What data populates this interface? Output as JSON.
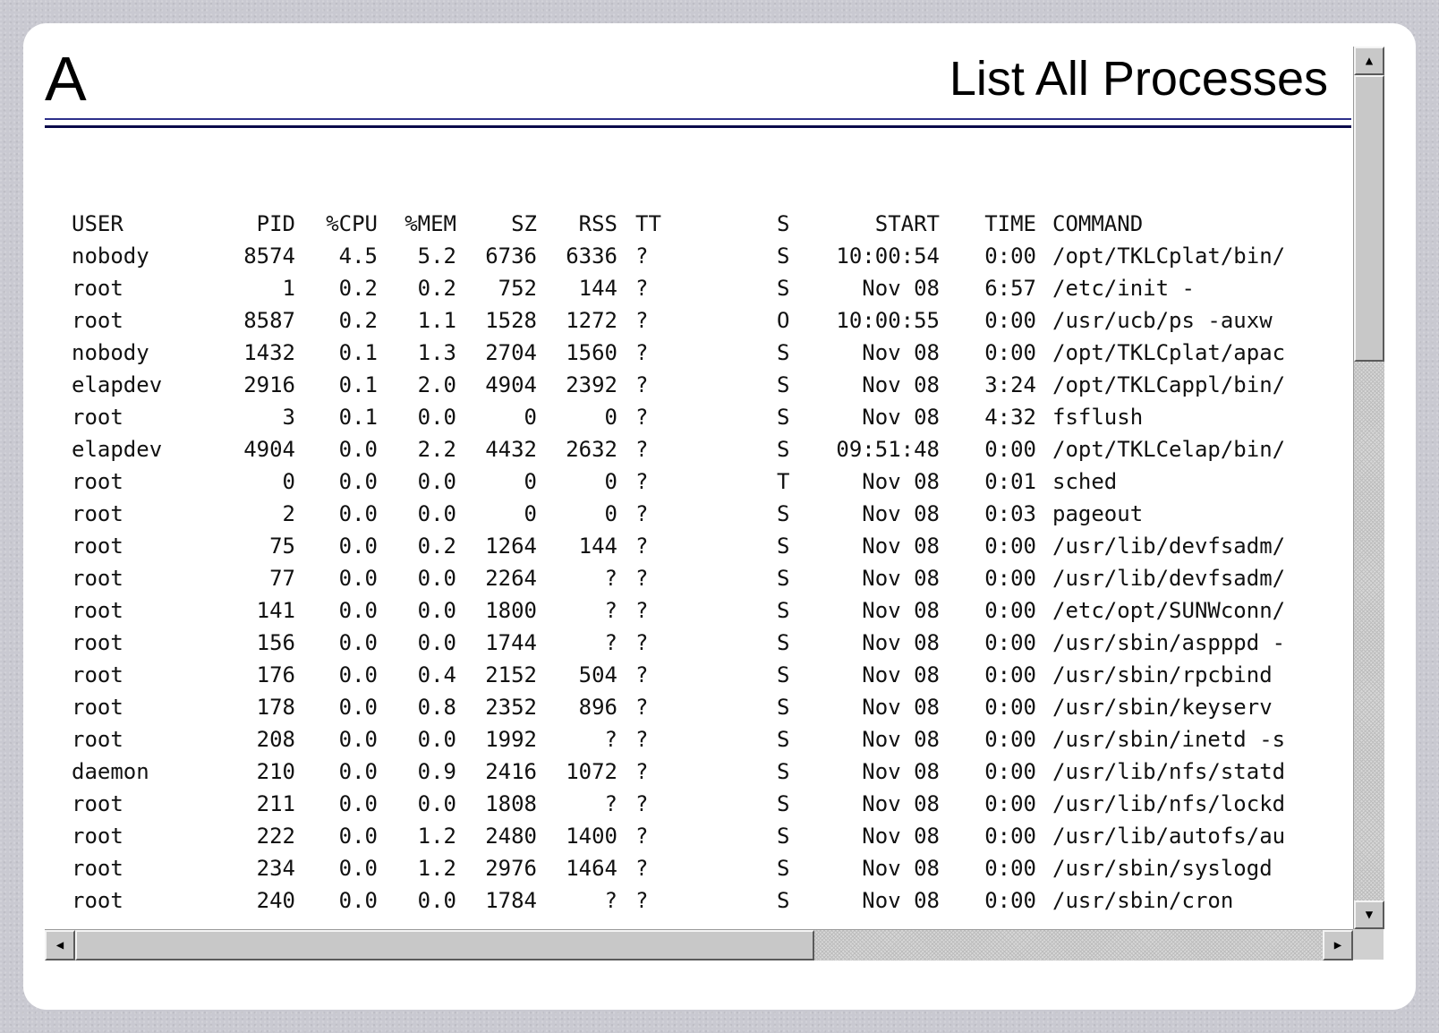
{
  "header": {
    "letter": "A",
    "title": "List All Processes"
  },
  "table": {
    "columns": {
      "user": "USER",
      "pid": "PID",
      "cpu": "%CPU",
      "mem": "%MEM",
      "sz": "SZ",
      "rss": "RSS",
      "tt": "TT",
      "s": "S",
      "start": "START",
      "time": "TIME",
      "command": "COMMAND"
    },
    "rows": [
      {
        "user": "nobody",
        "pid": "8574",
        "cpu": "4.5",
        "mem": "5.2",
        "sz": "6736",
        "rss": "6336",
        "tt": "?",
        "s": "S",
        "start": "10:00:54",
        "time": "0:00",
        "command": "/opt/TKLCplat/bin/"
      },
      {
        "user": "root",
        "pid": "1",
        "cpu": "0.2",
        "mem": "0.2",
        "sz": "752",
        "rss": "144",
        "tt": "?",
        "s": "S",
        "start": "Nov 08",
        "time": "6:57",
        "command": "/etc/init -"
      },
      {
        "user": "root",
        "pid": "8587",
        "cpu": "0.2",
        "mem": "1.1",
        "sz": "1528",
        "rss": "1272",
        "tt": "?",
        "s": "O",
        "start": "10:00:55",
        "time": "0:00",
        "command": "/usr/ucb/ps -auxw"
      },
      {
        "user": "nobody",
        "pid": "1432",
        "cpu": "0.1",
        "mem": "1.3",
        "sz": "2704",
        "rss": "1560",
        "tt": "?",
        "s": "S",
        "start": "Nov 08",
        "time": "0:00",
        "command": "/opt/TKLCplat/apac"
      },
      {
        "user": "elapdev",
        "pid": "2916",
        "cpu": "0.1",
        "mem": "2.0",
        "sz": "4904",
        "rss": "2392",
        "tt": "?",
        "s": "S",
        "start": "Nov 08",
        "time": "3:24",
        "command": "/opt/TKLCappl/bin/"
      },
      {
        "user": "root",
        "pid": "3",
        "cpu": "0.1",
        "mem": "0.0",
        "sz": "0",
        "rss": "0",
        "tt": "?",
        "s": "S",
        "start": "Nov 08",
        "time": "4:32",
        "command": "fsflush"
      },
      {
        "user": "elapdev",
        "pid": "4904",
        "cpu": "0.0",
        "mem": "2.2",
        "sz": "4432",
        "rss": "2632",
        "tt": "?",
        "s": "S",
        "start": "09:51:48",
        "time": "0:00",
        "command": "/opt/TKLCelap/bin/"
      },
      {
        "user": "root",
        "pid": "0",
        "cpu": "0.0",
        "mem": "0.0",
        "sz": "0",
        "rss": "0",
        "tt": "?",
        "s": "T",
        "start": "Nov 08",
        "time": "0:01",
        "command": "sched"
      },
      {
        "user": "root",
        "pid": "2",
        "cpu": "0.0",
        "mem": "0.0",
        "sz": "0",
        "rss": "0",
        "tt": "?",
        "s": "S",
        "start": "Nov 08",
        "time": "0:03",
        "command": "pageout"
      },
      {
        "user": "root",
        "pid": "75",
        "cpu": "0.0",
        "mem": "0.2",
        "sz": "1264",
        "rss": "144",
        "tt": "?",
        "s": "S",
        "start": "Nov 08",
        "time": "0:00",
        "command": "/usr/lib/devfsadm/"
      },
      {
        "user": "root",
        "pid": "77",
        "cpu": "0.0",
        "mem": "0.0",
        "sz": "2264",
        "rss": "?",
        "tt": "?",
        "s": "S",
        "start": "Nov 08",
        "time": "0:00",
        "command": "/usr/lib/devfsadm/"
      },
      {
        "user": "root",
        "pid": "141",
        "cpu": "0.0",
        "mem": "0.0",
        "sz": "1800",
        "rss": "?",
        "tt": "?",
        "s": "S",
        "start": "Nov 08",
        "time": "0:00",
        "command": "/etc/opt/SUNWconn/"
      },
      {
        "user": "root",
        "pid": "156",
        "cpu": "0.0",
        "mem": "0.0",
        "sz": "1744",
        "rss": "?",
        "tt": "?",
        "s": "S",
        "start": "Nov 08",
        "time": "0:00",
        "command": "/usr/sbin/aspppd -"
      },
      {
        "user": "root",
        "pid": "176",
        "cpu": "0.0",
        "mem": "0.4",
        "sz": "2152",
        "rss": "504",
        "tt": "?",
        "s": "S",
        "start": "Nov 08",
        "time": "0:00",
        "command": "/usr/sbin/rpcbind"
      },
      {
        "user": "root",
        "pid": "178",
        "cpu": "0.0",
        "mem": "0.8",
        "sz": "2352",
        "rss": "896",
        "tt": "?",
        "s": "S",
        "start": "Nov 08",
        "time": "0:00",
        "command": "/usr/sbin/keyserv"
      },
      {
        "user": "root",
        "pid": "208",
        "cpu": "0.0",
        "mem": "0.0",
        "sz": "1992",
        "rss": "?",
        "tt": "?",
        "s": "S",
        "start": "Nov 08",
        "time": "0:00",
        "command": "/usr/sbin/inetd -s"
      },
      {
        "user": "daemon",
        "pid": "210",
        "cpu": "0.0",
        "mem": "0.9",
        "sz": "2416",
        "rss": "1072",
        "tt": "?",
        "s": "S",
        "start": "Nov 08",
        "time": "0:00",
        "command": "/usr/lib/nfs/statd"
      },
      {
        "user": "root",
        "pid": "211",
        "cpu": "0.0",
        "mem": "0.0",
        "sz": "1808",
        "rss": "?",
        "tt": "?",
        "s": "S",
        "start": "Nov 08",
        "time": "0:00",
        "command": "/usr/lib/nfs/lockd"
      },
      {
        "user": "root",
        "pid": "222",
        "cpu": "0.0",
        "mem": "1.2",
        "sz": "2480",
        "rss": "1400",
        "tt": "?",
        "s": "S",
        "start": "Nov 08",
        "time": "0:00",
        "command": "/usr/lib/autofs/au"
      },
      {
        "user": "root",
        "pid": "234",
        "cpu": "0.0",
        "mem": "1.2",
        "sz": "2976",
        "rss": "1464",
        "tt": "?",
        "s": "S",
        "start": "Nov 08",
        "time": "0:00",
        "command": "/usr/sbin/syslogd"
      },
      {
        "user": "root",
        "pid": "240",
        "cpu": "0.0",
        "mem": "0.0",
        "sz": "1784",
        "rss": "?",
        "tt": "?",
        "s": "S",
        "start": "Nov 08",
        "time": "0:00",
        "command": "/usr/sbin/cron"
      }
    ]
  },
  "icons": {
    "scroll_up": "arrow-up-icon",
    "scroll_down": "arrow-down-icon",
    "scroll_left": "arrow-left-icon",
    "scroll_right": "arrow-right-icon"
  },
  "colors": {
    "header_rule_top": "#2c2f8a",
    "header_rule_bottom": "#0a0a4a",
    "background": "#c9c9d1"
  }
}
